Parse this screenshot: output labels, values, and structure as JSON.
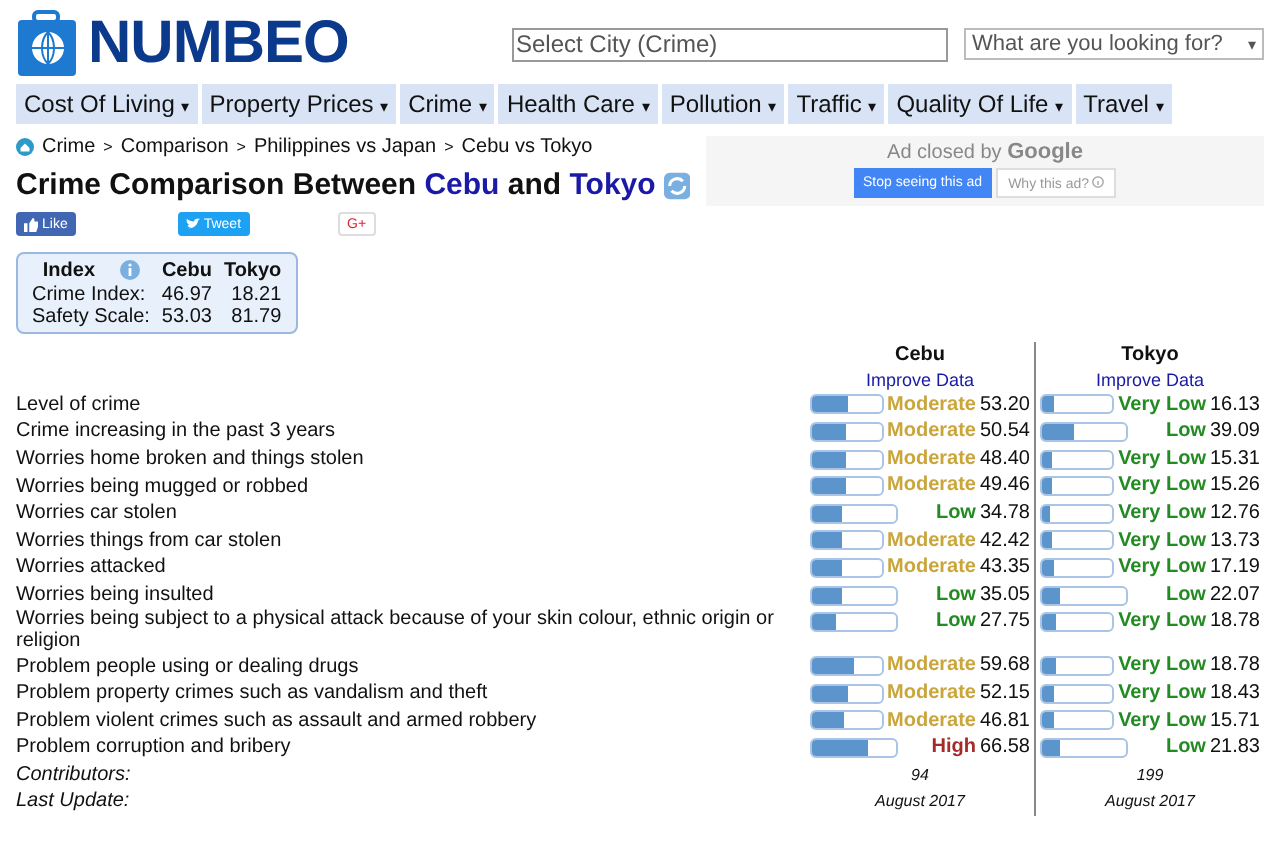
{
  "logo": {
    "text": "NUMBEO"
  },
  "search": {
    "placeholder": "Select City (Crime)"
  },
  "lookup": {
    "placeholder": "What are you looking for?",
    "caret": "▾"
  },
  "nav": [
    {
      "label": "Cost Of Living"
    },
    {
      "label": "Property Prices"
    },
    {
      "label": "Crime"
    },
    {
      "label": "Health Care"
    },
    {
      "label": "Pollution"
    },
    {
      "label": "Traffic"
    },
    {
      "label": "Quality Of Life"
    },
    {
      "label": "Travel"
    }
  ],
  "nav_caret": "▾",
  "breadcrumb": {
    "separator": ">",
    "items": [
      "Crime",
      "Comparison",
      "Philippines vs Japan",
      "Cebu vs Tokyo"
    ]
  },
  "title": {
    "prefix": "Crime Comparison Between",
    "city1": "Cebu",
    "middle": "and",
    "city2": "Tokyo"
  },
  "social": [
    {
      "kind": "like",
      "label": "Like"
    },
    {
      "kind": "tweet",
      "label": "Tweet"
    },
    {
      "kind": "gplus",
      "label": "G+"
    }
  ],
  "ad": {
    "text": "Ad closed by",
    "brand": "Google",
    "stop": "Stop seeing this ad",
    "why": "Why this ad?"
  },
  "index_table": {
    "columns": [
      "Index",
      "Cebu",
      "Tokyo"
    ],
    "rows": [
      {
        "label": "Crime Index:",
        "values": [
          "46.97",
          "18.21"
        ]
      },
      {
        "label": "Safety Scale:",
        "values": [
          "53.03",
          "81.79"
        ]
      }
    ]
  },
  "comparison": {
    "cities": [
      {
        "name": "Cebu",
        "link": "Improve Data"
      },
      {
        "name": "Tokyo",
        "link": "Improve Data"
      }
    ],
    "rows": [
      {
        "label": "Level of crime",
        "cells": [
          {
            "level": 0.532,
            "rating": "Moderate",
            "kind": "moderate",
            "value": "53.20"
          },
          {
            "level": 0.1613,
            "rating": "Very Low",
            "kind": "verylow",
            "value": "16.13"
          }
        ]
      },
      {
        "label": "Crime increasing in the past 3 years",
        "cells": [
          {
            "level": 0.5054,
            "rating": "Moderate",
            "kind": "moderate",
            "value": "50.54"
          },
          {
            "level": 0.3909,
            "rating": "Low",
            "kind": "low",
            "value": "39.09"
          }
        ]
      },
      {
        "label": "Worries home broken and things stolen",
        "cells": [
          {
            "level": 0.484,
            "rating": "Moderate",
            "kind": "moderate",
            "value": "48.40"
          },
          {
            "level": 0.1531,
            "rating": "Very Low",
            "kind": "verylow",
            "value": "15.31"
          }
        ]
      },
      {
        "label": "Worries being mugged or robbed",
        "cells": [
          {
            "level": 0.4946,
            "rating": "Moderate",
            "kind": "moderate",
            "value": "49.46"
          },
          {
            "level": 0.1526,
            "rating": "Very Low",
            "kind": "verylow",
            "value": "15.26"
          }
        ]
      },
      {
        "label": "Worries car stolen",
        "cells": [
          {
            "level": 0.3478,
            "rating": "Low",
            "kind": "low",
            "value": "34.78"
          },
          {
            "level": 0.1276,
            "rating": "Very Low",
            "kind": "verylow",
            "value": "12.76"
          }
        ]
      },
      {
        "label": "Worries things from car stolen",
        "cells": [
          {
            "level": 0.4242,
            "rating": "Moderate",
            "kind": "moderate",
            "value": "42.42"
          },
          {
            "level": 0.1373,
            "rating": "Very Low",
            "kind": "verylow",
            "value": "13.73"
          }
        ]
      },
      {
        "label": "Worries attacked",
        "cells": [
          {
            "level": 0.4335,
            "rating": "Moderate",
            "kind": "moderate",
            "value": "43.35"
          },
          {
            "level": 0.1719,
            "rating": "Very Low",
            "kind": "verylow",
            "value": "17.19"
          }
        ]
      },
      {
        "label": "Worries being insulted",
        "cells": [
          {
            "level": 0.3505,
            "rating": "Low",
            "kind": "low",
            "value": "35.05"
          },
          {
            "level": 0.2207,
            "rating": "Low",
            "kind": "low",
            "value": "22.07"
          }
        ]
      },
      {
        "label": "Worries being subject to a physical attack because of your skin colour, ethnic origin or religion",
        "cells": [
          {
            "level": 0.2775,
            "rating": "Low",
            "kind": "low",
            "value": "27.75"
          },
          {
            "level": 0.1878,
            "rating": "Very Low",
            "kind": "verylow",
            "value": "18.78"
          }
        ]
      },
      {
        "label": "Problem people using or dealing drugs",
        "cells": [
          {
            "level": 0.5968,
            "rating": "Moderate",
            "kind": "moderate",
            "value": "59.68"
          },
          {
            "level": 0.1878,
            "rating": "Very Low",
            "kind": "verylow",
            "value": "18.78"
          }
        ]
      },
      {
        "label": "Problem property crimes such as vandalism and theft",
        "cells": [
          {
            "level": 0.5215,
            "rating": "Moderate",
            "kind": "moderate",
            "value": "52.15"
          },
          {
            "level": 0.1843,
            "rating": "Very Low",
            "kind": "verylow",
            "value": "18.43"
          }
        ]
      },
      {
        "label": "Problem violent crimes such as assault and armed robbery",
        "cells": [
          {
            "level": 0.4681,
            "rating": "Moderate",
            "kind": "moderate",
            "value": "46.81"
          },
          {
            "level": 0.1571,
            "rating": "Very Low",
            "kind": "verylow",
            "value": "15.71"
          }
        ]
      },
      {
        "label": "Problem corruption and bribery",
        "cells": [
          {
            "level": 0.6658,
            "rating": "High",
            "kind": "high",
            "value": "66.58"
          },
          {
            "level": 0.2183,
            "rating": "Low",
            "kind": "low",
            "value": "21.83"
          }
        ]
      }
    ],
    "footer": [
      {
        "label": "Contributors:",
        "values": [
          "94",
          "199"
        ]
      },
      {
        "label": "Last Update:",
        "values": [
          "August 2017",
          "August 2017"
        ]
      }
    ]
  }
}
